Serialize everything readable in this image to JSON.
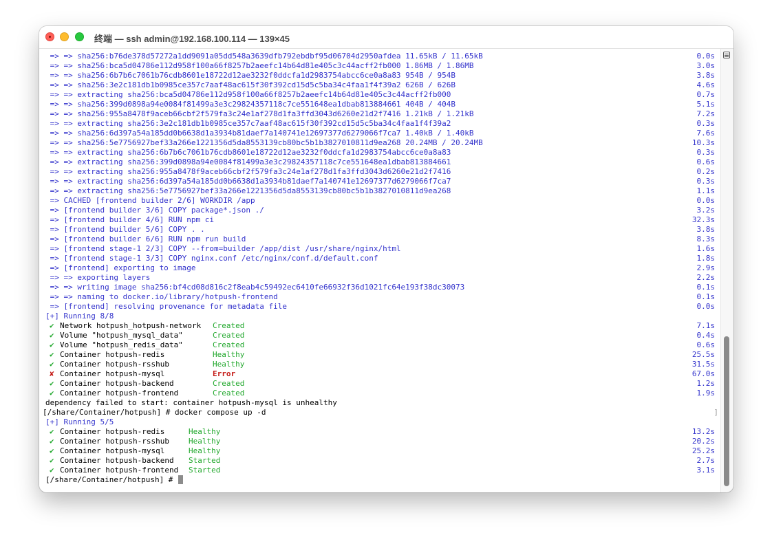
{
  "window": {
    "title": "终端 — ssh admin@192.168.100.114 — 139×45"
  },
  "colors": {
    "blue": "#3333cc",
    "green": "#22a82d",
    "red": "#c41a16",
    "text": "#000000"
  },
  "lines": [
    {
      "text": " => => sha256:b76de378d57272a1dd9091a05dd548a3639dfb792ebdbf95d06704d2950afdea 11.65kB / 11.65kB",
      "time": "0.0s",
      "color": "blue"
    },
    {
      "text": " => => sha256:bca5d04786e112d958f100a66f8257b2aeefc14b64d81e405c3c44acff2fb000 1.86MB / 1.86MB",
      "time": "3.0s",
      "color": "blue"
    },
    {
      "text": " => => sha256:6b7b6c7061b76cdb8601e18722d12ae3232f0ddcfa1d2983754abcc6ce0a8a83 954B / 954B",
      "time": "3.8s",
      "color": "blue"
    },
    {
      "text": " => => sha256:3e2c181db1b0985ce357c7aaf48ac615f30f392cd15d5c5ba34c4faa1f4f39a2 626B / 626B",
      "time": "4.6s",
      "color": "blue"
    },
    {
      "text": " => => extracting sha256:bca5d04786e112d958f100a66f8257b2aeefc14b64d81e405c3c44acff2fb000",
      "time": "0.7s",
      "color": "blue"
    },
    {
      "text": " => => sha256:399d0898a94e0084f81499a3e3c29824357118c7ce551648ea1dbab813884661 404B / 404B",
      "time": "5.1s",
      "color": "blue"
    },
    {
      "text": " => => sha256:955a8478f9aceb66cbf2f579fa3c24e1af278d1fa3ffd3043d6260e21d2f7416 1.21kB / 1.21kB",
      "time": "7.2s",
      "color": "blue"
    },
    {
      "text": " => => extracting sha256:3e2c181db1b0985ce357c7aaf48ac615f30f392cd15d5c5ba34c4faa1f4f39a2",
      "time": "0.3s",
      "color": "blue"
    },
    {
      "text": " => => sha256:6d397a54a185dd0b6638d1a3934b81daef7a140741e12697377d6279066f7ca7 1.40kB / 1.40kB",
      "time": "7.6s",
      "color": "blue"
    },
    {
      "text": " => => sha256:5e7756927bef33a266e1221356d5da8553139cb80bc5b1b3827010811d9ea268 20.24MB / 20.24MB",
      "time": "10.3s",
      "color": "blue"
    },
    {
      "text": " => => extracting sha256:6b7b6c7061b76cdb8601e18722d12ae3232f0ddcfa1d2983754abcc6ce0a8a83",
      "time": "0.3s",
      "color": "blue"
    },
    {
      "text": " => => extracting sha256:399d0898a94e0084f81499a3e3c29824357118c7ce551648ea1dbab813884661",
      "time": "0.6s",
      "color": "blue"
    },
    {
      "text": " => => extracting sha256:955a8478f9aceb66cbf2f579fa3c24e1af278d1fa3ffd3043d6260e21d2f7416",
      "time": "0.2s",
      "color": "blue"
    },
    {
      "text": " => => extracting sha256:6d397a54a185dd0b6638d1a3934b81daef7a140741e12697377d6279066f7ca7",
      "time": "0.3s",
      "color": "blue"
    },
    {
      "text": " => => extracting sha256:5e7756927bef33a266e1221356d5da8553139cb80bc5b1b3827010811d9ea268",
      "time": "1.1s",
      "color": "blue"
    },
    {
      "text": " => CACHED [frontend builder 2/6] WORKDIR /app",
      "time": "0.0s",
      "color": "blue"
    },
    {
      "text": " => [frontend builder 3/6] COPY package*.json ./",
      "time": "3.2s",
      "color": "blue"
    },
    {
      "text": " => [frontend builder 4/6] RUN npm ci",
      "time": "32.3s",
      "color": "blue"
    },
    {
      "text": " => [frontend builder 5/6] COPY . .",
      "time": "3.8s",
      "color": "blue"
    },
    {
      "text": " => [frontend builder 6/6] RUN npm run build",
      "time": "8.3s",
      "color": "blue"
    },
    {
      "text": " => [frontend stage-1 2/3] COPY --from=builder /app/dist /usr/share/nginx/html",
      "time": "1.6s",
      "color": "blue"
    },
    {
      "text": " => [frontend stage-1 3/3] COPY nginx.conf /etc/nginx/conf.d/default.conf",
      "time": "1.8s",
      "color": "blue"
    },
    {
      "text": " => [frontend] exporting to image",
      "time": "2.9s",
      "color": "blue"
    },
    {
      "text": " => => exporting layers",
      "time": "2.2s",
      "color": "blue"
    },
    {
      "text": " => => writing image sha256:bf4cd08d816c2f8eab4c59492ec6410fe66932f36d1021fc64e193f38dc30073",
      "time": "0.1s",
      "color": "blue"
    },
    {
      "text": " => => naming to docker.io/library/hotpush-frontend",
      "time": "0.1s",
      "color": "blue"
    },
    {
      "text": " => [frontend] resolving provenance for metadata file",
      "time": "0.0s",
      "color": "blue"
    },
    {
      "text": "[+] Running 8/8",
      "time": "",
      "color": "blue"
    }
  ],
  "run1": [
    {
      "mark": "✔",
      "ok": true,
      "name": "Network hotpush_hotpush-network",
      "status": "Created",
      "time": "7.1s"
    },
    {
      "mark": "✔",
      "ok": true,
      "name": "Volume \"hotpush_mysql_data\"",
      "status": "Created",
      "time": "0.4s"
    },
    {
      "mark": "✔",
      "ok": true,
      "name": "Volume \"hotpush_redis_data\"",
      "status": "Created",
      "time": "0.6s"
    },
    {
      "mark": "✔",
      "ok": true,
      "name": "Container hotpush-redis",
      "status": "Healthy",
      "time": "25.5s"
    },
    {
      "mark": "✔",
      "ok": true,
      "name": "Container hotpush-rsshub",
      "status": "Healthy",
      "time": "31.5s"
    },
    {
      "mark": "✘",
      "ok": false,
      "name": "Container hotpush-mysql",
      "status": "Error",
      "time": "67.0s"
    },
    {
      "mark": "✔",
      "ok": true,
      "name": "Container hotpush-backend",
      "status": "Created",
      "time": "1.2s"
    },
    {
      "mark": "✔",
      "ok": true,
      "name": "Container hotpush-frontend",
      "status": "Created",
      "time": "1.9s"
    }
  ],
  "error_line": "dependency failed to start: container hotpush-mysql is unhealthy",
  "command_line": "[/share/Container/hotpush] # docker compose up -d",
  "running2": "[+] Running 5/5",
  "run2": [
    {
      "mark": "✔",
      "ok": true,
      "name": "Container hotpush-redis",
      "status": "Healthy",
      "time": "13.2s"
    },
    {
      "mark": "✔",
      "ok": true,
      "name": "Container hotpush-rsshub",
      "status": "Healthy",
      "time": "20.2s"
    },
    {
      "mark": "✔",
      "ok": true,
      "name": "Container hotpush-mysql",
      "status": "Healthy",
      "time": "25.2s"
    },
    {
      "mark": "✔",
      "ok": true,
      "name": "Container hotpush-backend",
      "status": "Started",
      "time": "2.7s"
    },
    {
      "mark": "✔",
      "ok": true,
      "name": "Container hotpush-frontend",
      "status": "Started",
      "time": "3.1s"
    }
  ],
  "prompt": "[/share/Container/hotpush] #"
}
